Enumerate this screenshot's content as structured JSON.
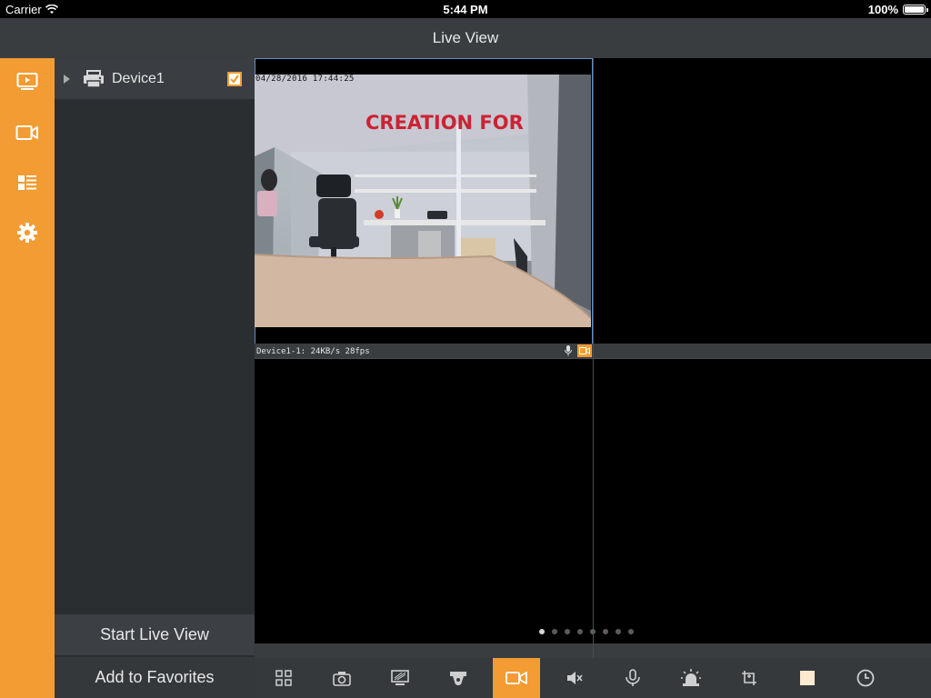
{
  "status_bar": {
    "carrier": "Carrier",
    "time": "5:44 PM",
    "battery": "100%"
  },
  "header": {
    "title": "Live View"
  },
  "rail": {
    "items": [
      {
        "icon": "playback-screen-icon"
      },
      {
        "icon": "camera-icon"
      },
      {
        "icon": "list-icon"
      },
      {
        "icon": "gear-icon"
      }
    ]
  },
  "device_panel": {
    "device": {
      "name": "Device1",
      "checked": true
    },
    "start_live_view_label": "Start Live View",
    "add_to_favorites_label": "Add to Favorites"
  },
  "live_grid": {
    "tile1": {
      "timestamp": "04/28/2016 17:44:25",
      "sign_text": "CREATION FOR",
      "info": "Device1-1: 24KB/s 28fps"
    },
    "page_dots": 8,
    "active_page": 1
  },
  "toolbar": {
    "buttons": [
      "grid-layout-icon",
      "snapshot-icon",
      "image-quality-icon",
      "ptz-icon",
      "record-icon",
      "mute-icon",
      "talk-icon",
      "alarm-icon",
      "digital-zoom-icon",
      "stop-icon",
      "clock-icon"
    ],
    "selected": "record-icon"
  },
  "colors": {
    "accent": "#f29c33",
    "selection_border": "#5c8ec7"
  }
}
